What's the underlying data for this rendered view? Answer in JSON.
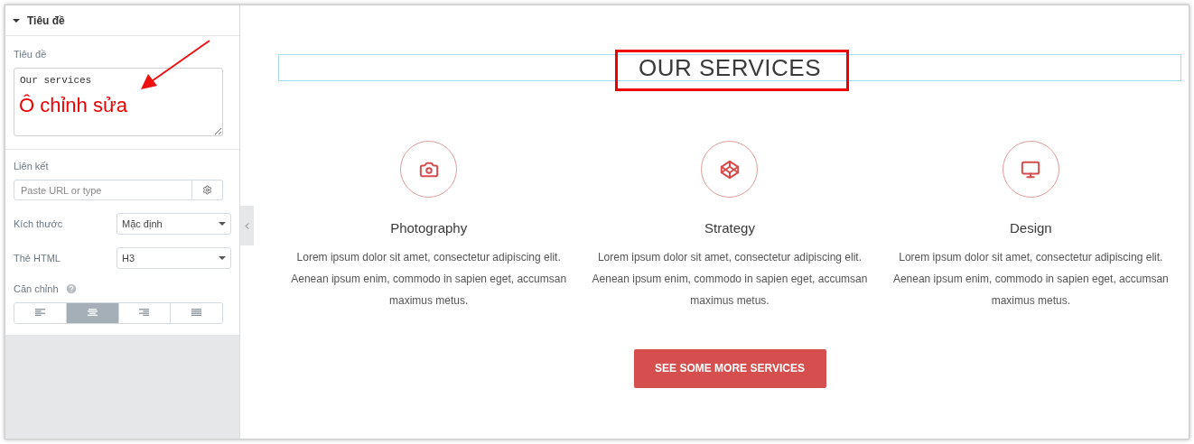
{
  "panel": {
    "section": {
      "title": "Tiêu đề",
      "expanded": true
    },
    "title_field": {
      "label": "Tiêu đề",
      "value": "Our services"
    },
    "link_field": {
      "label": "Liên kết",
      "placeholder": "Paste URL or type"
    },
    "size": {
      "label": "Kích thước",
      "value": "Mặc định"
    },
    "html_tag": {
      "label": "Thẻ HTML",
      "value": "H3"
    },
    "alignment": {
      "label": "Căn chỉnh",
      "options": [
        {
          "kind": "left",
          "selected": false
        },
        {
          "kind": "center",
          "selected": true
        },
        {
          "kind": "right",
          "selected": false
        },
        {
          "kind": "justify",
          "selected": false
        }
      ]
    }
  },
  "annotation": {
    "text": "Ô chỉnh sửa"
  },
  "preview": {
    "heading": "OUR SERVICES",
    "services": [
      {
        "kind": "camera",
        "title": "Photography",
        "text": "Lorem ipsum dolor sit amet, consectetur adipiscing elit. Aenean ipsum enim, commodo in sapien eget, accumsan maximus metus."
      },
      {
        "kind": "cube",
        "title": "Strategy",
        "text": "Lorem ipsum dolor sit amet, consectetur adipiscing elit. Aenean ipsum enim, commodo in sapien eget, accumsan maximus metus."
      },
      {
        "kind": "monitor",
        "title": "Design",
        "text": "Lorem ipsum dolor sit amet, consectetur adipiscing elit. Aenean ipsum enim, commodo in sapien eget, accumsan maximus metus."
      }
    ],
    "button": "SEE SOME MORE SERVICES"
  }
}
